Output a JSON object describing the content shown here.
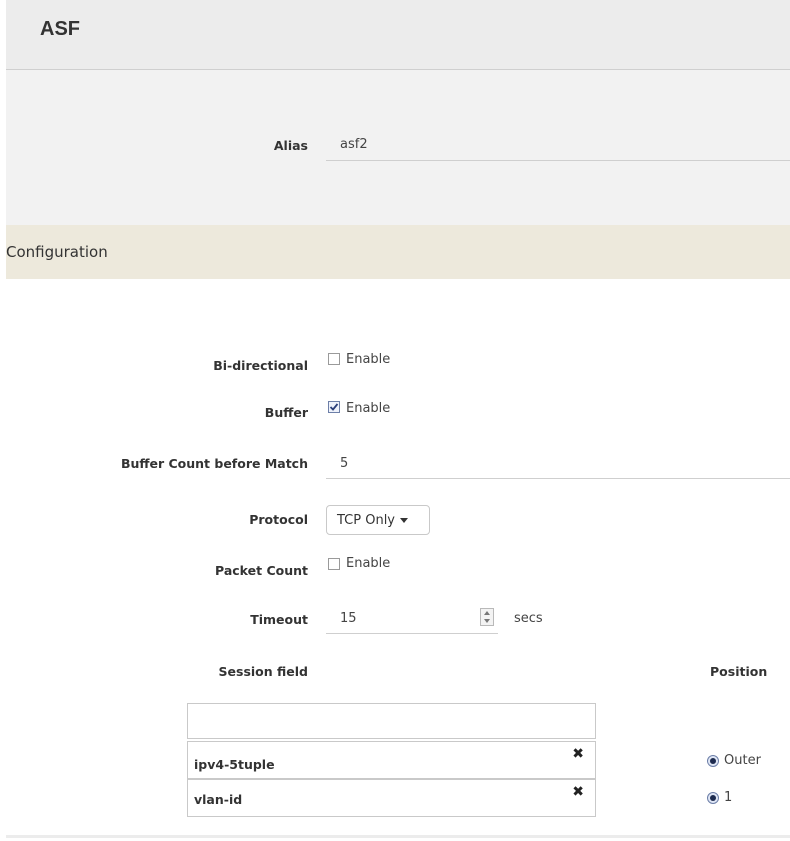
{
  "header": {
    "title": "ASF"
  },
  "alias": {
    "label": "Alias",
    "value": "asf2"
  },
  "config": {
    "title": "Configuration",
    "bidirectional": {
      "label": "Bi-directional",
      "checkbox_label": "Enable",
      "checked": false
    },
    "buffer": {
      "label": "Buffer",
      "checkbox_label": "Enable",
      "checked": true
    },
    "buffer_count": {
      "label": "Buffer Count before Match",
      "value": "5"
    },
    "protocol": {
      "label": "Protocol",
      "selected": "TCP Only"
    },
    "packet_count": {
      "label": "Packet Count",
      "checkbox_label": "Enable",
      "checked": false
    },
    "timeout": {
      "label": "Timeout",
      "value": "15",
      "unit": "secs"
    }
  },
  "session": {
    "field_header": "Session field",
    "position_header": "Position",
    "input_value": "",
    "rows": [
      {
        "field": "ipv4-5tuple",
        "position": "Outer"
      },
      {
        "field": "vlan-id",
        "position": "1"
      }
    ]
  }
}
